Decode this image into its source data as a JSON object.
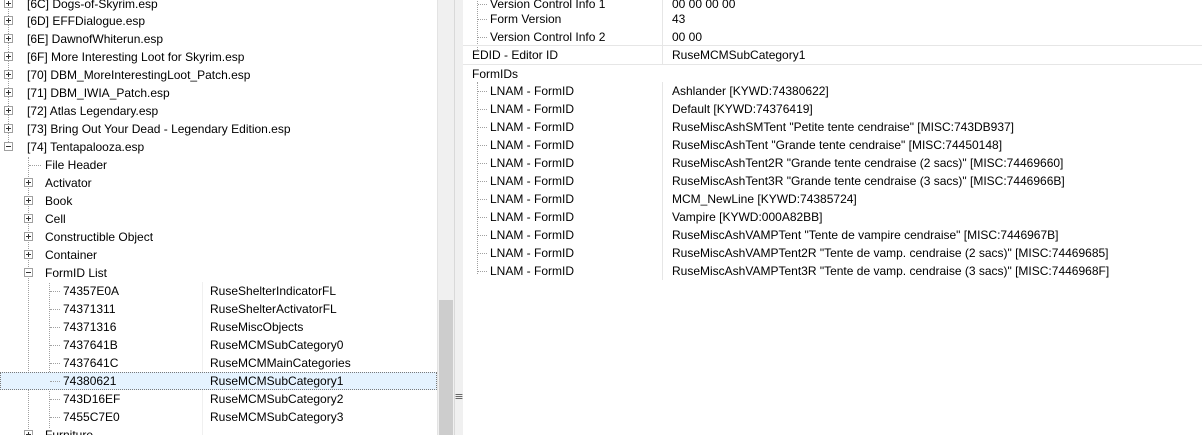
{
  "tree": {
    "plugins": [
      {
        "label": "[6C] Dogs-of-Skyrim.esp",
        "expanded": false
      },
      {
        "label": "[6D] EFFDialogue.esp",
        "expanded": false
      },
      {
        "label": "[6E] DawnofWhiterun.esp",
        "expanded": false
      },
      {
        "label": "[6F] More Interesting Loot for Skyrim.esp",
        "expanded": false
      },
      {
        "label": "[70] DBM_MoreInterestingLoot_Patch.esp",
        "expanded": false
      },
      {
        "label": "[71] DBM_IWIA_Patch.esp",
        "expanded": false
      },
      {
        "label": "[72] Atlas Legendary.esp",
        "expanded": false
      },
      {
        "label": "[73] Bring Out Your Dead - Legendary Edition.esp",
        "expanded": false
      },
      {
        "label": "[74] Tentapalooza.esp",
        "expanded": true
      }
    ],
    "groups": [
      {
        "label": "File Header",
        "expandable": false
      },
      {
        "label": "Activator",
        "expandable": true
      },
      {
        "label": "Book",
        "expandable": true
      },
      {
        "label": "Cell",
        "expandable": true
      },
      {
        "label": "Constructible Object",
        "expandable": true
      },
      {
        "label": "Container",
        "expandable": true
      },
      {
        "label": "FormID List",
        "expandable": true,
        "expanded": true
      }
    ],
    "formid_list": [
      {
        "id": "74357E0A",
        "edid": "RuseShelterIndicatorFL"
      },
      {
        "id": "74371311",
        "edid": "RuseShelterActivatorFL"
      },
      {
        "id": "74371316",
        "edid": "RuseMiscObjects"
      },
      {
        "id": "7437641B",
        "edid": "RuseMCMSubCategory0"
      },
      {
        "id": "7437641C",
        "edid": "RuseMCMMainCategories"
      },
      {
        "id": "74380621",
        "edid": "RuseMCMSubCategory1",
        "selected": true
      },
      {
        "id": "743D16EF",
        "edid": "RuseMCMSubCategory2"
      },
      {
        "id": "7455C7E0",
        "edid": "RuseMCMSubCategory3"
      }
    ],
    "next_group": "Furniture"
  },
  "record_view": {
    "header_rows": [
      {
        "name": "Version Control Info 1",
        "value": "00 00 00 00"
      },
      {
        "name": "Form Version",
        "value": "43"
      },
      {
        "name": "Version Control Info 2",
        "value": "00 00"
      }
    ],
    "edid": {
      "name": "EDID - Editor ID",
      "value": "RuseMCMSubCategory1"
    },
    "formids_label": "FormIDs",
    "lnam_rows": [
      {
        "name": "LNAM - FormID",
        "value": "Ashlander [KYWD:74380622]"
      },
      {
        "name": "LNAM - FormID",
        "value": "Default [KYWD:74376419]"
      },
      {
        "name": "LNAM - FormID",
        "value": "RuseMiscAshSMTent \"Petite tente cendraise\" [MISC:743DB937]"
      },
      {
        "name": "LNAM - FormID",
        "value": "RuseMiscAshTent \"Grande tente cendraise\" [MISC:74450148]"
      },
      {
        "name": "LNAM - FormID",
        "value": "RuseMiscAshTent2R \"Grande tente cendraise (2 sacs)\" [MISC:74469660]"
      },
      {
        "name": "LNAM - FormID",
        "value": "RuseMiscAshTent3R \"Grande tente cendraise (3 sacs)\" [MISC:7446966B]"
      },
      {
        "name": "LNAM - FormID",
        "value": "MCM_NewLine [KYWD:74385724]"
      },
      {
        "name": "LNAM - FormID",
        "value": "Vampire [KYWD:000A82BB]"
      },
      {
        "name": "LNAM - FormID",
        "value": "RuseMiscAshVAMPTent \"Tente de vampire cendraise\" [MISC:7446967B]"
      },
      {
        "name": "LNAM - FormID",
        "value": "RuseMiscAshVAMPTent2R \"Tente de vamp. cendraise (2 sacs)\" [MISC:74469685]"
      },
      {
        "name": "LNAM - FormID",
        "value": "RuseMiscAshVAMPTent3R \"Tente de vamp. cendraise (3 sacs)\" [MISC:7446968F]"
      }
    ]
  },
  "splitter": {
    "grip_glyph": "≡"
  },
  "colors": {
    "selection": "#e5f3ff",
    "divider": "#e6e6e6",
    "scrollbar": "#f0f0f0"
  }
}
